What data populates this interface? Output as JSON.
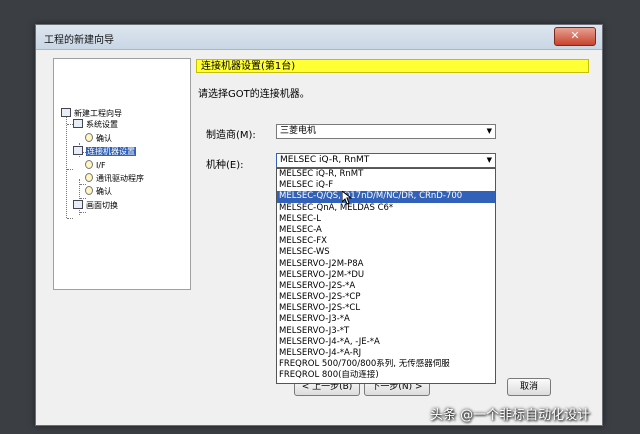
{
  "window": {
    "title": "工程的新建向导",
    "close_label": "✕"
  },
  "tree": {
    "items": [
      {
        "label": "新建工程向导"
      },
      {
        "label": "系统设置"
      },
      {
        "label": "确认"
      },
      {
        "label": "连接机器设置"
      },
      {
        "label": "I/F"
      },
      {
        "label": "通讯驱动程序"
      },
      {
        "label": "确认"
      },
      {
        "label": "画面切换"
      }
    ]
  },
  "main": {
    "header": "连接机器设置(第1台)",
    "instruction": "请选择GOT的连接机器。",
    "maker_label": "制造商(M):",
    "maker_value": "三菱电机",
    "model_label": "机种(E):",
    "model_value": "MELSEC iQ-R, RnMT"
  },
  "dropdown": {
    "options": [
      "MELSEC iQ-R, RnMT",
      "MELSEC iQ-F",
      "MELSEC-Q/QS, Q17nD/M/NC/DR, CRnD-700",
      "MELSEC-QnA, MELDAS C6*",
      "MELSEC-L",
      "MELSEC-A",
      "MELSEC-FX",
      "MELSEC-WS",
      "MELSERVO-J2M-P8A",
      "MELSERVO-J2M-*DU",
      "MELSERVO-J2S-*A",
      "MELSERVO-J2S-*CP",
      "MELSERVO-J2S-*CL",
      "MELSERVO-J3-*A",
      "MELSERVO-J3-*T",
      "MELSERVO-J4-*A, -JE-*A",
      "MELSERVO-J4-*A-RJ",
      "FREQROL 500/700/800系列, 无传感器伺服",
      "FREQROL 800(自动连接)"
    ],
    "highlighted_index": 2
  },
  "buttons": {
    "back": "< 上一步(B)",
    "next": "下一步(N) >",
    "cancel": "取消"
  },
  "watermark": "头条 @一个非标自动化设计"
}
